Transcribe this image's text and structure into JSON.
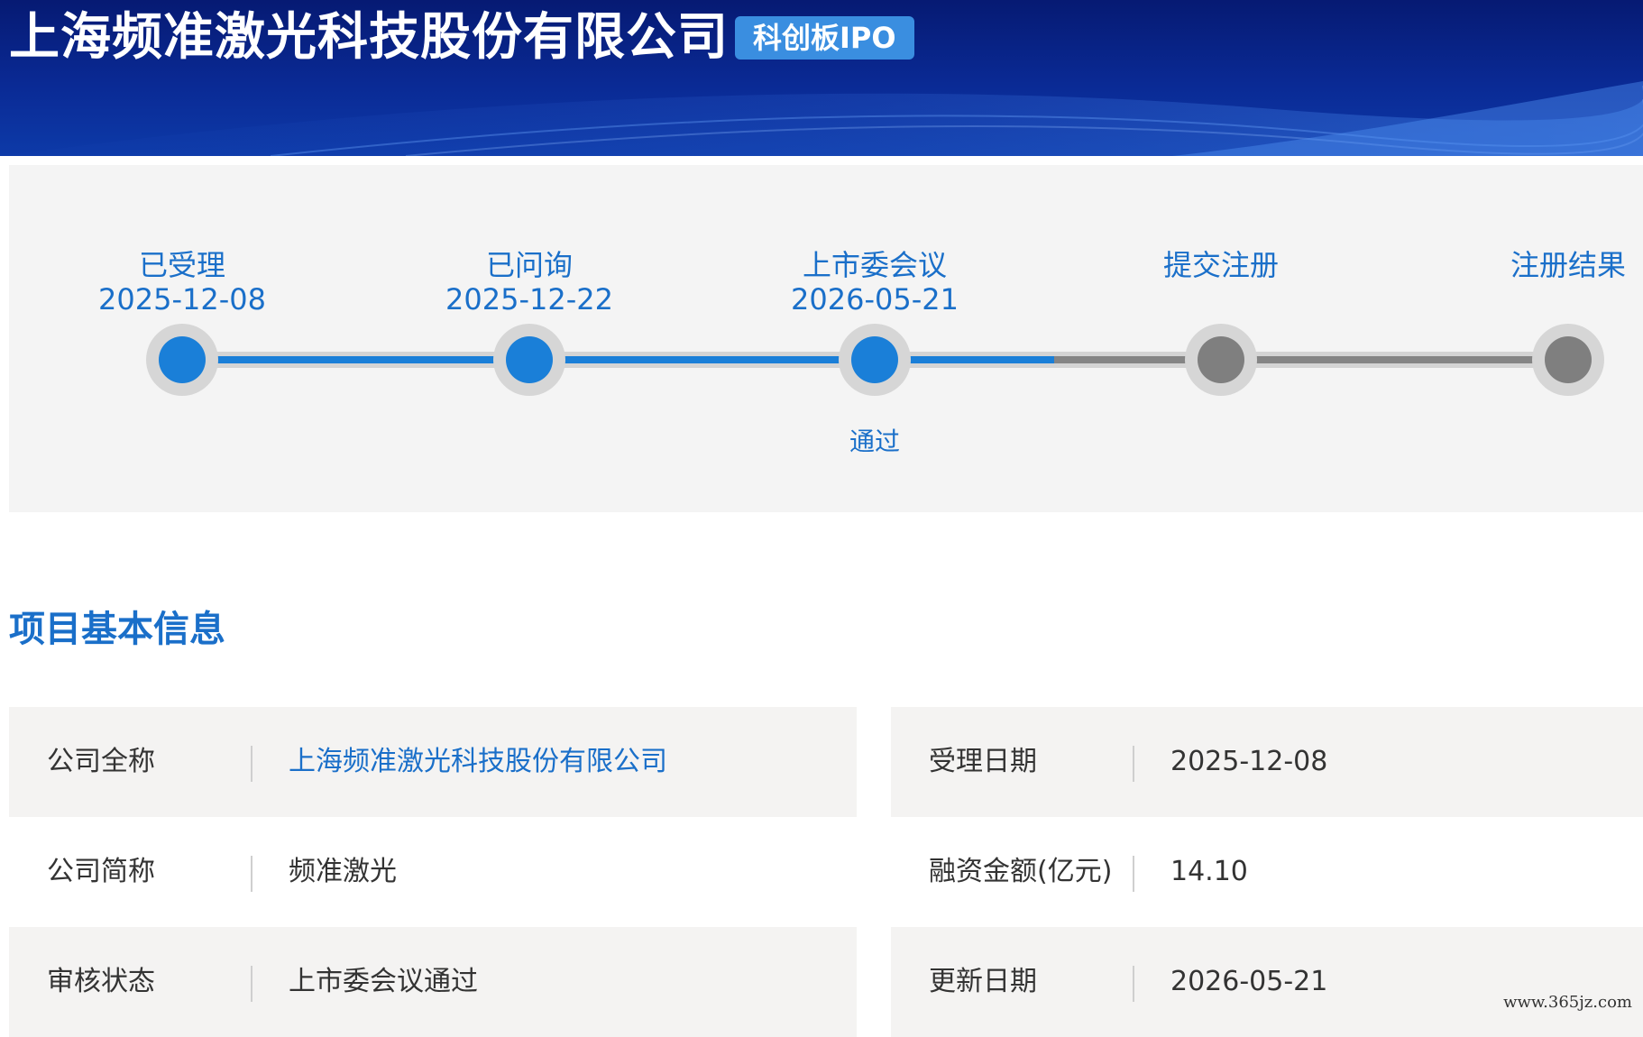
{
  "header": {
    "company_name": "上海频准激光科技股份有限公司",
    "board_badge": "科创板IPO"
  },
  "progress": {
    "steps": [
      {
        "label": "已受理",
        "date": "2025-12-08",
        "status": "done",
        "note": ""
      },
      {
        "label": "已问询",
        "date": "2025-12-22",
        "status": "done",
        "note": ""
      },
      {
        "label": "上市委会议",
        "date": "2026-05-21",
        "status": "done",
        "note": "通过"
      },
      {
        "label": "提交注册",
        "date": "",
        "status": "pending",
        "note": ""
      },
      {
        "label": "注册结果",
        "date": "",
        "status": "pending",
        "note": ""
      }
    ],
    "colors": {
      "done": "#1a7fd8",
      "pending": "#7f7f7f"
    }
  },
  "section": {
    "title": "项目基本信息"
  },
  "info": {
    "rows": [
      {
        "left": {
          "label": "公司全称",
          "value": "上海频准激光科技股份有限公司"
        },
        "right": {
          "label": "受理日期",
          "value": "2025-12-08"
        }
      },
      {
        "left": {
          "label": "公司简称",
          "value": "频准激光"
        },
        "right": {
          "label": "融资金额(亿元)",
          "value": "14.10"
        }
      },
      {
        "left": {
          "label": "审核状态",
          "value": "上市委会议通过"
        },
        "right": {
          "label": "更新日期",
          "value": "2026-05-21"
        }
      }
    ]
  },
  "watermark": "www.365jz.com"
}
